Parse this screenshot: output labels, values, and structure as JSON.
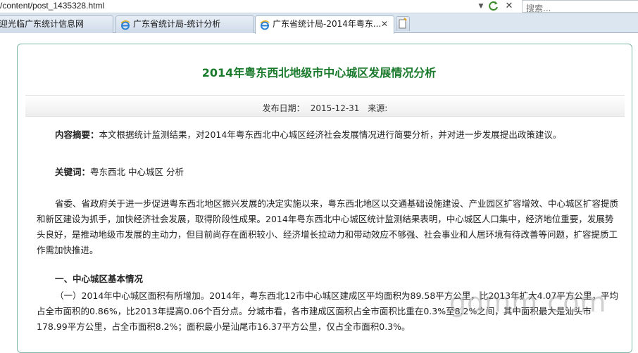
{
  "browser": {
    "url": "/content/post_1435328.html",
    "search_placeholder": "搜索...",
    "tabs": [
      {
        "label": "迎光临广东统计信息网"
      },
      {
        "label": "广东省统计局-统计分析"
      },
      {
        "label": "广东省统计局-2014年粤东..."
      }
    ]
  },
  "article": {
    "title": "2014年粤东西北地级市中心城区发展情况分析",
    "publish_label": "发布日期：",
    "publish_date": "2015-12-31",
    "source_label": "来源:",
    "summary_label": "内容摘要：",
    "summary_text": "本文根据统计监测结果，对2014年粤东西北中心城区经济社会发展情况进行简要分析，并对进一步发展提出政策建议。",
    "keywords_label": "关键词：",
    "keywords_text": "粤东西北  中心城区  分析",
    "paragraph1": "省委、省政府关于进一步促进粤东西北地区振兴发展的决定实施以来，粤东西北地区以交通基础设施建设、产业园区扩容增效、中心城区扩容提质和新区建设为抓手，加快经济社会发展，取得阶段性成果。2014年粤东西北中心城区统计监测结果表明，中心城区人口集中，经济地位重要，发展势头良好，是推动地级市发展的主动力，但目前尚存在面积较小、经济增长拉动力和带动效应不够强、社会事业和人居环境有待改善等问题，扩容提质工作需加快推进。",
    "section1_heading": "一、中心城区基本情况",
    "paragraph2": "（一）2014年中心城区面积有所增加。2014年，粤东西北12市中心城区建成区平均面积为89.58平方公里，比2013年扩大4.07平方公里，平均占全市面积的0.86%，比2013年提高0.06个百分点。分城市看，各市建成区面积占全市面积比重在0.3%至8.2%之间，其中面积最大是汕头市178.99平方公里，占全市面积8.2%；面积最小是汕尾市16.37平方公里，仅占全市面积0.3%。"
  },
  "watermark": "gdmm.com"
}
